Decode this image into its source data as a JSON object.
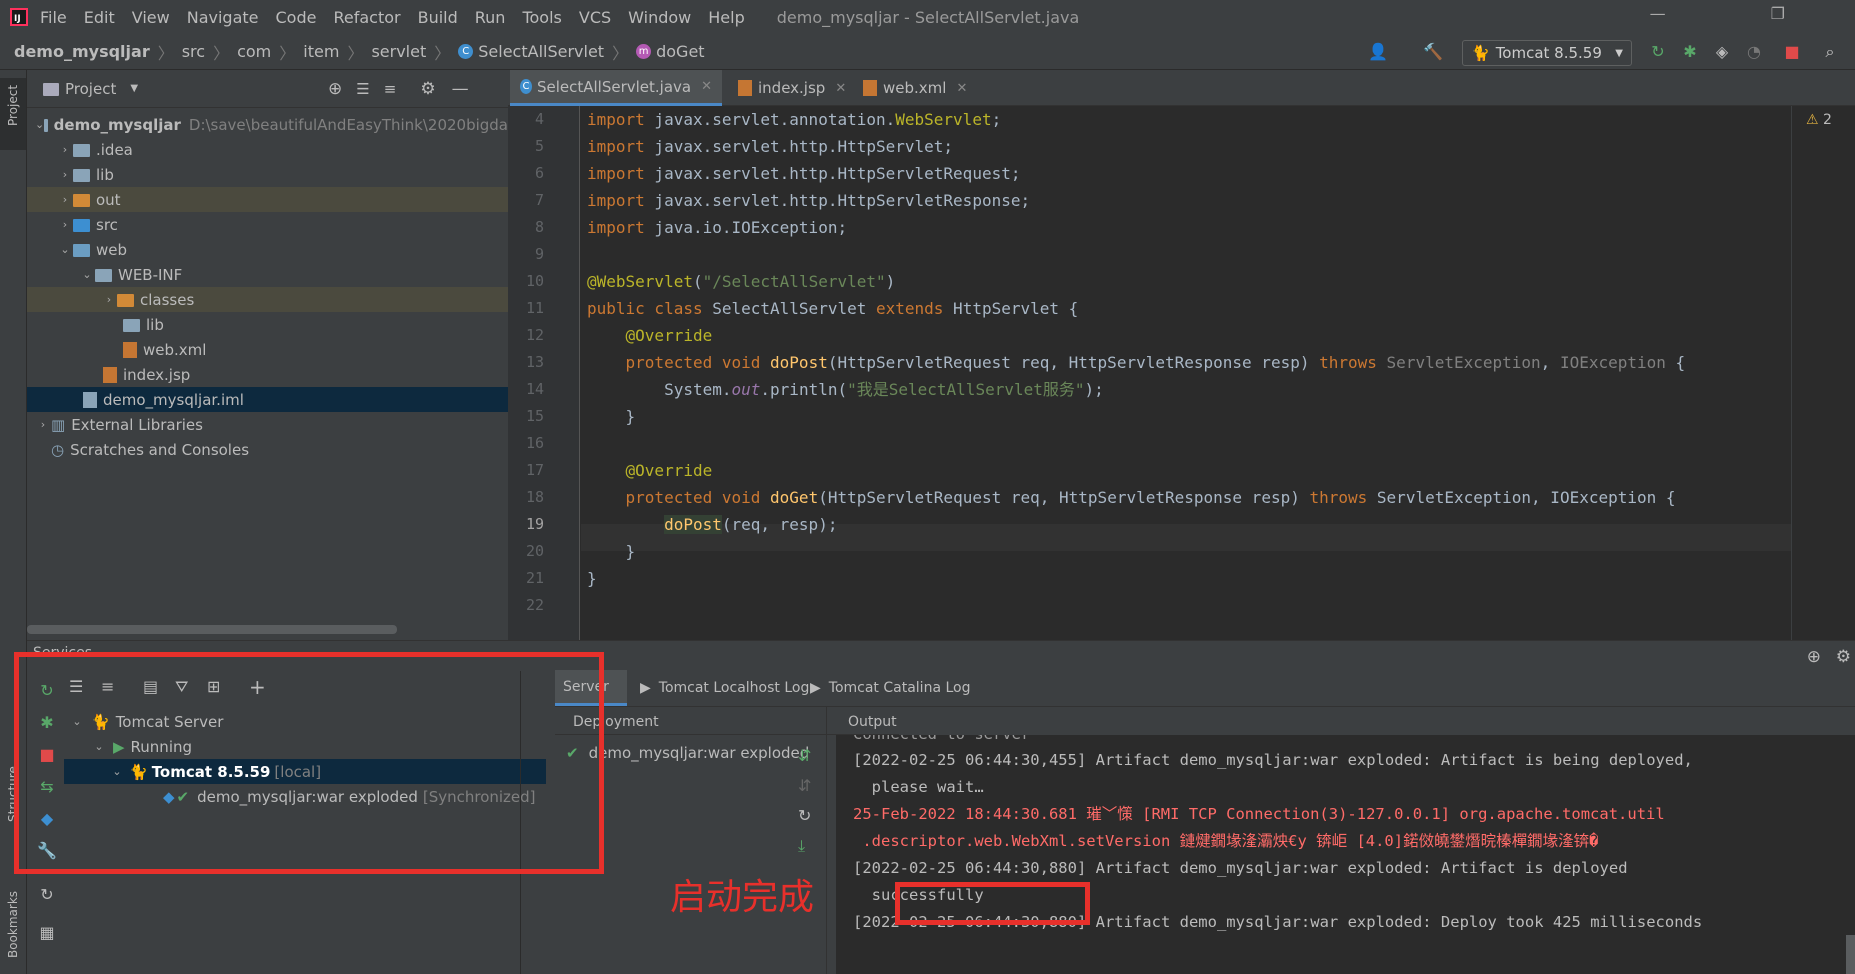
{
  "menu": {
    "items": [
      "File",
      "Edit",
      "View",
      "Navigate",
      "Code",
      "Refactor",
      "Build",
      "Run",
      "Tools",
      "VCS",
      "Window",
      "Help"
    ],
    "window_title": "demo_mysqljar - SelectAllServlet.java"
  },
  "nav": {
    "crumbs": [
      "demo_mysqljar",
      "src",
      "com",
      "item",
      "servlet",
      "SelectAllServlet",
      "doGet"
    ],
    "run_config": "Tomcat 8.5.59"
  },
  "stripe": {
    "project": "Project",
    "structure": "Structure",
    "bookmarks": "Bookmarks"
  },
  "project": {
    "header": "Project",
    "root_name": "demo_mysqljar",
    "root_path": "D:\\save\\beautifulAndEasyThink\\2020bigda",
    "items": [
      ".idea",
      "lib",
      "out",
      "src",
      "web",
      "WEB-INF",
      "classes",
      "lib",
      "web.xml",
      "index.jsp",
      "demo_mysqljar.iml",
      "External Libraries",
      "Scratches and Consoles"
    ]
  },
  "editor": {
    "tabs": [
      "SelectAllServlet.java",
      "index.jsp",
      "web.xml"
    ],
    "warnings": "2",
    "line_numbers": [
      "4",
      "5",
      "6",
      "7",
      "8",
      "9",
      "10",
      "11",
      "12",
      "13",
      "14",
      "15",
      "16",
      "17",
      "18",
      "19",
      "20",
      "21",
      "22"
    ]
  },
  "services": {
    "title": "Services",
    "tree": {
      "server": "Tomcat Server",
      "state": "Running",
      "instance": "Tomcat 8.5.59",
      "instance_tag": "[local]",
      "artifact": "demo_mysqljar:war exploded",
      "artifact_tag": "[Synchronized]"
    },
    "tabs": [
      "Server",
      "Tomcat Localhost Log",
      "Tomcat Catalina Log"
    ],
    "deployment_header": "Deployment",
    "deployment_item": "demo_mysqljar:war exploded",
    "output_header": "Output",
    "output_lines": [
      "Connected to server",
      "[2022-02-25 06:44:30,455] Artifact demo_mysqljar:war exploded: Artifact is being deployed,",
      "  please wait…",
      "25-Feb-2022 18:44:30.681 璀﹀憡 [RMI TCP Connection(3)-127.0.0.1] org.apache.tomcat.util",
      " .descriptor.web.WebXml.setVersion 鏈煡鐗堟湰灞炴€у 锛岠 [4.0]鍩傚皢鐢熸晥榛樿鐗堟湰锛�",
      "[2022-02-25 06:44:30,880] Artifact demo_mysqljar:war exploded: Artifact is deployed",
      "  successfully",
      "[2022-02-25 06:44:30,880] Artifact demo_mysqljar:war exploded: Deploy took 425 milliseconds"
    ],
    "annotation": "启动完成"
  },
  "colors": {
    "annotation_red": "#e8302b",
    "accent_blue": "#4a88c7"
  }
}
